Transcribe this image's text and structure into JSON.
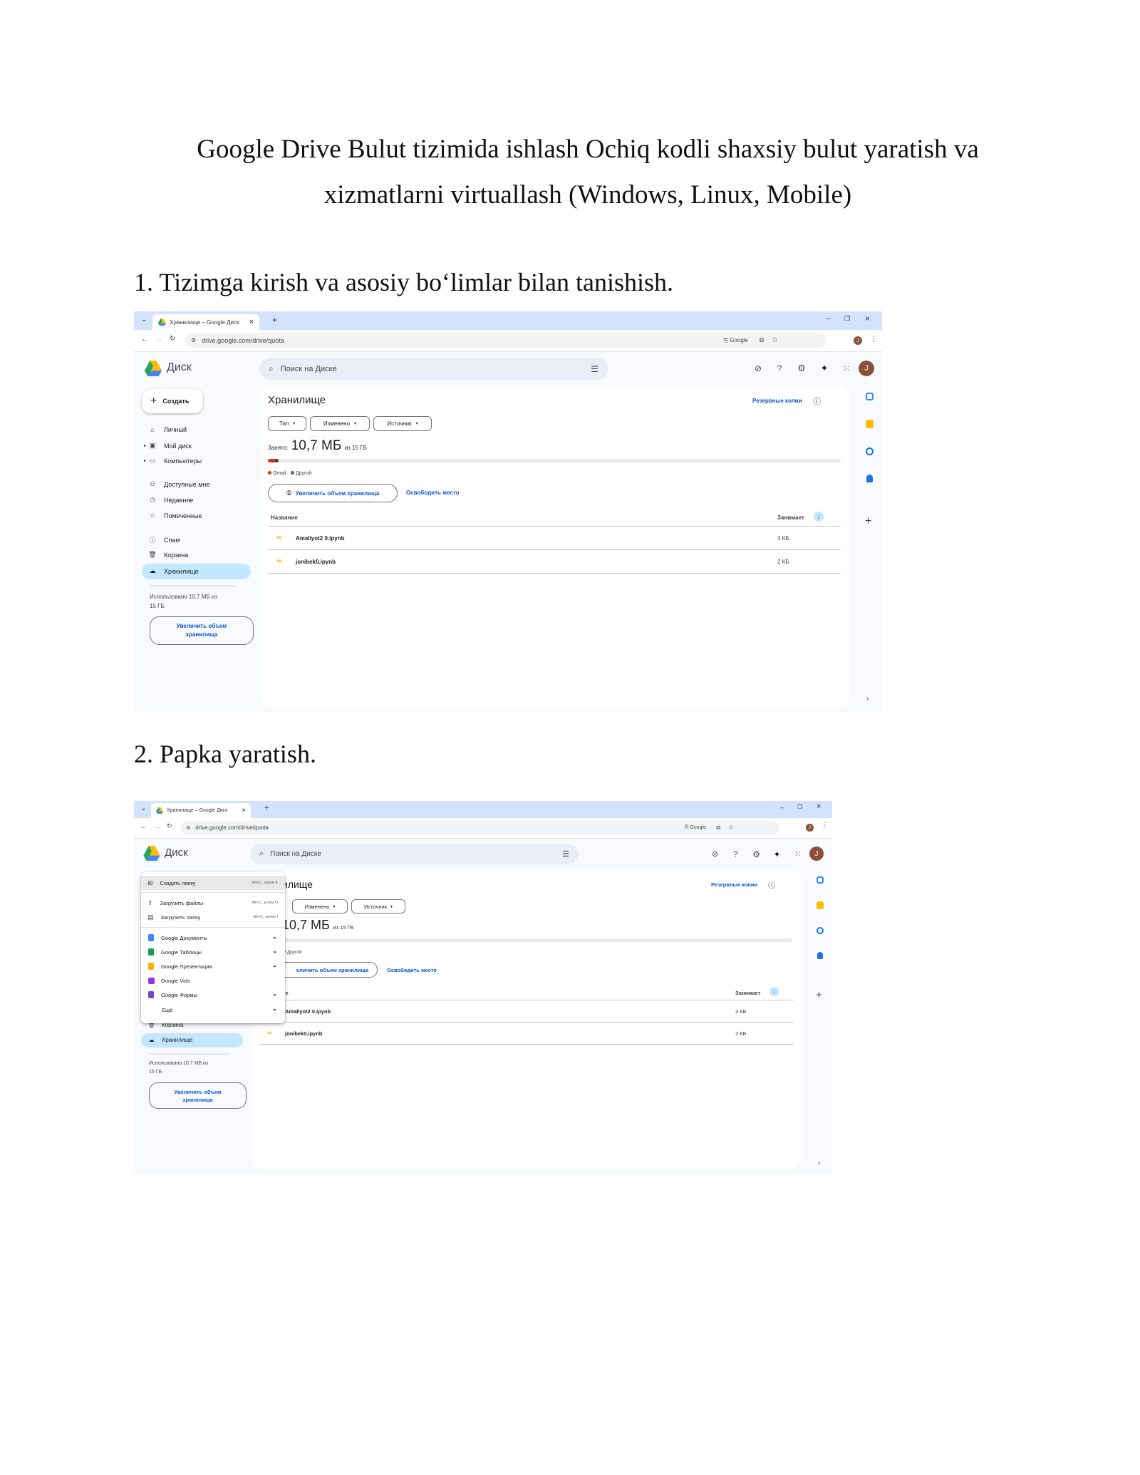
{
  "doc": {
    "title_line1": "Google Drive Bulut tizimida ishlash Ochiq kodli shaxsiy bulut yaratish va",
    "title_line2": "xizmatlarni virtuallash (Windows, Linux, Mobile)",
    "section1": "1. Tizimga kirish va asosiy bo‘limlar bilan tanishish.",
    "section2": "2. Papka yaratish."
  },
  "browser": {
    "tab_title": "Хранилище – Google Диск",
    "url": "drive.google.com/drive/quota",
    "google_chip": "Google",
    "avatar_letter": "J",
    "new_tab": "+",
    "close_tab": "×",
    "minimize": "–",
    "maximize": "❐",
    "close_win": "×"
  },
  "drive": {
    "brand": "Диск",
    "search_placeholder": "Поиск на Диске",
    "create_button": "Создать",
    "sidebar": {
      "personal": "Личный",
      "my_drive": "Мой диск",
      "computers": "Компьютеры",
      "shared": "Доступные мне",
      "recent": "Недавние",
      "starred": "Помеченные",
      "spam": "Спам",
      "trash": "Корзина",
      "storage": "Хранилище"
    },
    "usage_text_1": "Использовано 10,7 МБ из",
    "usage_text_2": "15 ГБ",
    "usage_fraction": 0.0007,
    "upgrade_btn_1": "Увеличить объем",
    "upgrade_btn_2": "хранилища",
    "page_title": "Хранилище",
    "backup_link": "Резервные копии",
    "filters": {
      "type": "Тип",
      "modified": "Изменено",
      "source": "Источник"
    },
    "used_label": "Занято:",
    "used_value": "10,7 МБ",
    "used_of": "из 15 ГБ",
    "legend_gmail": "Gmail",
    "legend_other": "Другой",
    "gmail_color": "#d93025",
    "other_color": "#5f6368",
    "increase_storage_btn": "Увеличить объем хранилища",
    "free_space_link": "Освободить место",
    "col_name": "Название",
    "col_size": "Занимает",
    "files": [
      {
        "name": "Amaliyot2 0.ipynb",
        "size": "3 КБ"
      },
      {
        "name": "jonibek0.ipynb",
        "size": "2 КБ"
      }
    ],
    "menu": {
      "new_folder": "Создать папку",
      "new_folder_sc": "Alt+C, затем F",
      "upload_files": "Загрузить файлы",
      "upload_files_sc": "Alt+C, затем U",
      "upload_folder": "Загрузить папку",
      "upload_folder_sc": "Alt+C, затем I",
      "docs": "Google Документы",
      "sheets": "Google Таблицы",
      "slides": "Google Презентации",
      "vids": "Google Vids",
      "forms": "Google Формы",
      "more": "Ещё"
    },
    "partial_title": "илище",
    "partial_used": "10,7 МБ",
    "partial_increase": "еличить объем хранилища",
    "partial_name_col": "не",
    "accent": "#0b57d0",
    "active_bg": "#c2e7ff"
  }
}
